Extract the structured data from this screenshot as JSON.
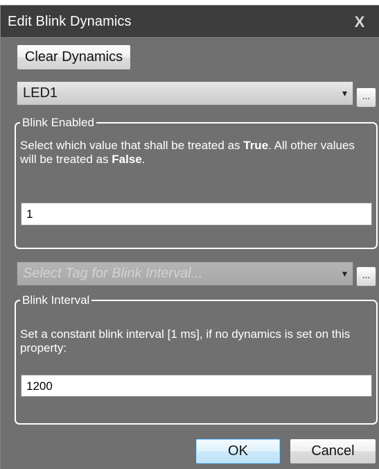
{
  "window": {
    "title": "Edit Blink Dynamics",
    "close_glyph": "X"
  },
  "toolbar": {
    "clear_label": "Clear Dynamics"
  },
  "enabled_tag": {
    "value": "LED1",
    "arrow": "▾",
    "browse_label": "..."
  },
  "blink_enabled": {
    "legend": "Blink Enabled",
    "desc_before_true": "Select which value that shall be treated as ",
    "true_word": "True",
    "desc_after_true": ". All other values will be treated as ",
    "false_word": "False",
    "desc_end": ".",
    "value": "1"
  },
  "interval_tag": {
    "placeholder": "Select Tag for Blink Interval...",
    "arrow": "▾",
    "browse_label": "..."
  },
  "blink_interval": {
    "legend": "Blink Interval",
    "desc": "Set a constant blink interval [1 ms], if no dynamics is set on this property:",
    "value": "1200"
  },
  "buttons": {
    "ok_label": "OK",
    "cancel_label": "Cancel"
  },
  "colors": {
    "titlebar": "#3d3d3d",
    "dialog_bg": "#707070",
    "ok_accent": "#3c7fb1"
  }
}
